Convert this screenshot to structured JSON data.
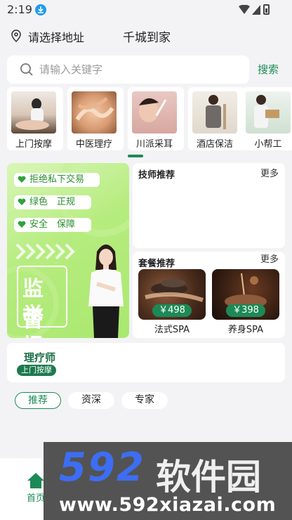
{
  "status_bar": {
    "time": "2:19"
  },
  "header": {
    "location": "请选择地址",
    "brand": "千城到家"
  },
  "search": {
    "placeholder": "请输入关键字",
    "button": "搜索"
  },
  "categories": [
    {
      "label": "上门按摩"
    },
    {
      "label": "中医理疗"
    },
    {
      "label": "川派采耳"
    },
    {
      "label": "酒店保洁"
    },
    {
      "label": "小帮工"
    }
  ],
  "promo": {
    "badges": [
      "拒绝私下交易",
      "绿色　正规",
      "安全　保障"
    ],
    "headline_1": "监督",
    "headline_2": "举报"
  },
  "tech_card": {
    "title": "技师推荐",
    "more": "更多"
  },
  "package_card": {
    "title": "套餐推荐",
    "more": "更多",
    "items": [
      {
        "price": "￥498",
        "name": "法式SPA"
      },
      {
        "price": "￥398",
        "name": "养身SPA"
      }
    ]
  },
  "therapist": {
    "title": "理疗师",
    "tag": "上门按摩"
  },
  "filters": [
    "推荐",
    "资深",
    "专家"
  ],
  "bottom_nav": {
    "home": "首页"
  },
  "watermark": {
    "logo_num": "592",
    "logo_cn": "软件园",
    "url": "www.592xiazai.com"
  },
  "colors": {
    "accent": "#1c8a56",
    "promo_green": "#a9e86e",
    "watermark_blue": "#3d6df2"
  }
}
